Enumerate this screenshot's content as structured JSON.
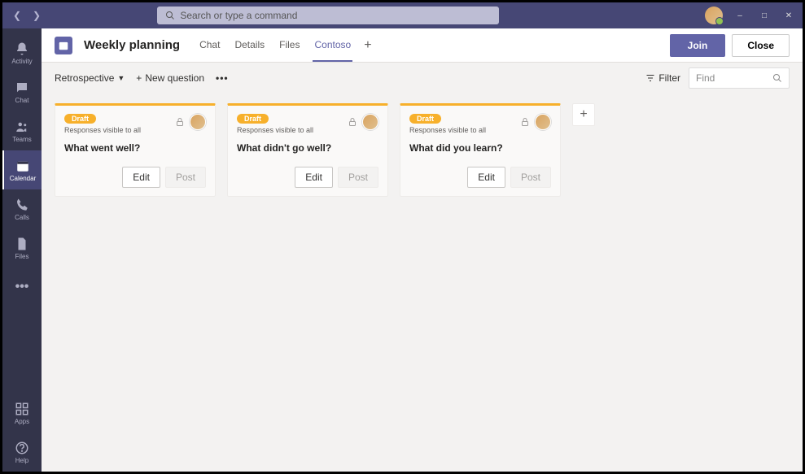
{
  "titlebar": {
    "search_placeholder": "Search or type a command"
  },
  "rail": {
    "items": [
      {
        "label": "Activity",
        "icon": "bell"
      },
      {
        "label": "Chat",
        "icon": "chat"
      },
      {
        "label": "Teams",
        "icon": "teams"
      },
      {
        "label": "Calendar",
        "icon": "calendar",
        "active": true
      },
      {
        "label": "Calls",
        "icon": "calls"
      },
      {
        "label": "Files",
        "icon": "files"
      }
    ],
    "apps_label": "Apps",
    "help_label": "Help"
  },
  "tabbar": {
    "title": "Weekly planning",
    "tabs": [
      {
        "label": "Chat",
        "active": false
      },
      {
        "label": "Details",
        "active": false
      },
      {
        "label": "Files",
        "active": false
      },
      {
        "label": "Contoso",
        "active": true
      }
    ],
    "join_label": "Join",
    "close_label": "Close"
  },
  "toolbar": {
    "dropdown_label": "Retrospective",
    "new_question_label": "New question",
    "filter_label": "Filter",
    "find_placeholder": "Find"
  },
  "cards": [
    {
      "badge": "Draft",
      "subtitle": "Responses visible to all",
      "question": "What went well?",
      "edit_label": "Edit",
      "post_label": "Post"
    },
    {
      "badge": "Draft",
      "subtitle": "Responses visible to all",
      "question": "What didn't go well?",
      "edit_label": "Edit",
      "post_label": "Post"
    },
    {
      "badge": "Draft",
      "subtitle": "Responses visible to all",
      "question": "What did you learn?",
      "edit_label": "Edit",
      "post_label": "Post"
    }
  ]
}
